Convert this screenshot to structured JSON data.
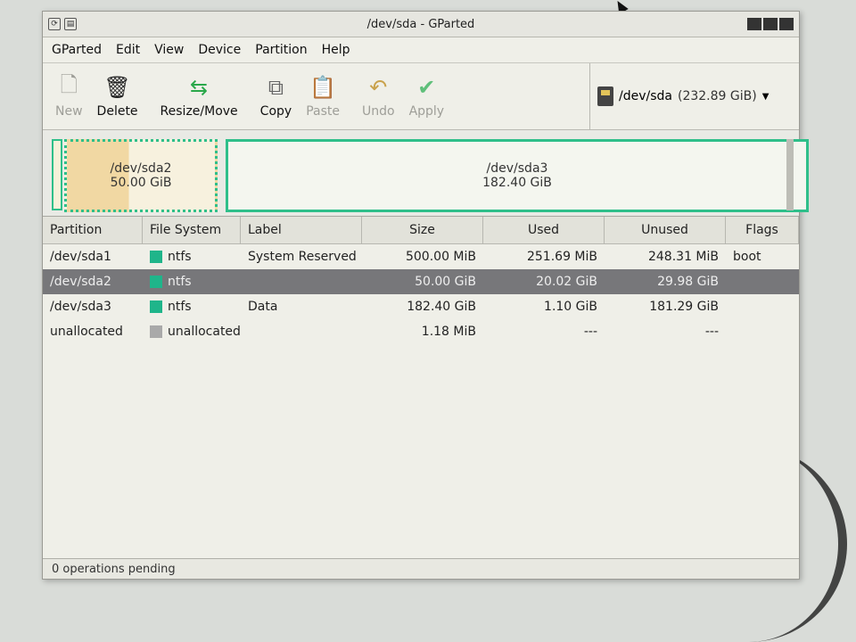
{
  "window": {
    "title": "/dev/sda - GParted"
  },
  "menu": [
    "GParted",
    "Edit",
    "View",
    "Device",
    "Partition",
    "Help"
  ],
  "toolbar": {
    "buttons": [
      {
        "label": "New",
        "icon": "new-page-icon",
        "enabled": false
      },
      {
        "label": "Delete",
        "icon": "trash-icon",
        "enabled": true
      },
      {
        "label": "Resize/Move",
        "icon": "resize-move-icon",
        "enabled": true
      },
      {
        "label": "Copy",
        "icon": "copy-icon",
        "enabled": true
      },
      {
        "label": "Paste",
        "icon": "paste-icon",
        "enabled": false
      },
      {
        "label": "Undo",
        "icon": "undo-icon",
        "enabled": false
      },
      {
        "label": "Apply",
        "icon": "apply-check-icon",
        "enabled": false
      }
    ],
    "device": {
      "name": "/dev/sda",
      "size": "(232.89 GiB)"
    }
  },
  "graph": {
    "segments": [
      {
        "name": "/dev/sda2",
        "size": "50.00 GiB"
      },
      {
        "name": "/dev/sda3",
        "size": "182.40 GiB"
      }
    ]
  },
  "table": {
    "headers": [
      "Partition",
      "File System",
      "Label",
      "Size",
      "Used",
      "Unused",
      "Flags"
    ],
    "rows": [
      {
        "partition": "/dev/sda1",
        "fs": "ntfs",
        "fs_color": "#1fb58a",
        "label": "System Reserved",
        "size": "500.00 MiB",
        "used": "251.69 MiB",
        "unused": "248.31 MiB",
        "flags": "boot",
        "selected": false
      },
      {
        "partition": "/dev/sda2",
        "fs": "ntfs",
        "fs_color": "#1fb58a",
        "label": "",
        "size": "50.00 GiB",
        "used": "20.02 GiB",
        "unused": "29.98 GiB",
        "flags": "",
        "selected": true
      },
      {
        "partition": "/dev/sda3",
        "fs": "ntfs",
        "fs_color": "#1fb58a",
        "label": "Data",
        "size": "182.40 GiB",
        "used": "1.10 GiB",
        "unused": "181.29 GiB",
        "flags": "",
        "selected": false
      },
      {
        "partition": "unallocated",
        "fs": "unallocated",
        "fs_color": "#a9a9a9",
        "label": "",
        "size": "1.18 MiB",
        "used": "---",
        "unused": "---",
        "flags": "",
        "selected": false
      }
    ]
  },
  "status": {
    "text": "0 operations pending"
  }
}
